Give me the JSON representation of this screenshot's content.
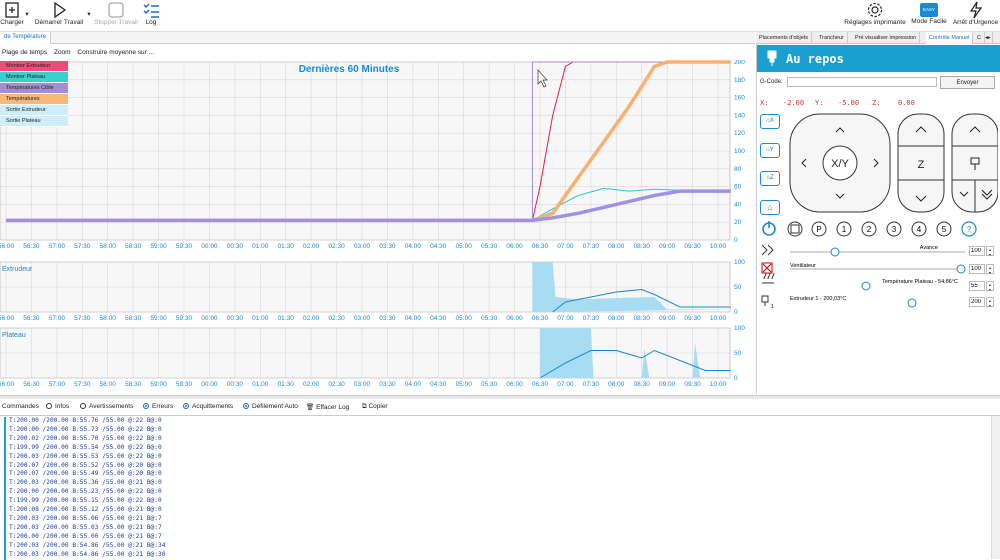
{
  "toolbar": {
    "load_label": "Charger",
    "start_label": "Démarrer Travail",
    "stop_label": "Stopper Travail",
    "log_label": "Log",
    "printer_settings_label": "Réglages imprimante",
    "easy_mode_label": "Mode Facile",
    "easy_badge": "EASY",
    "emergency_label": "Arrêt d'Urgence"
  },
  "left_tab": "de Température",
  "chart_menu": [
    "Plage de temps",
    "Zoom",
    "Construire moyenne sur ..."
  ],
  "legend": [
    {
      "label": "Montrer Extrudeur",
      "color": "#f04a7a"
    },
    {
      "label": "Montrer Plateau",
      "color": "#39d0d0"
    },
    {
      "label": "Températures Cible",
      "color": "#a98ad6"
    },
    {
      "label": "Températures",
      "color": "#f9b87a"
    },
    {
      "label": "Sortie Extrudeur",
      "color": "#cdeefa"
    },
    {
      "label": "Sortie Plateau",
      "color": "#cdeefa"
    }
  ],
  "chart_data": [
    {
      "type": "line",
      "title": "Dernières 60 Minutes",
      "x": [
        "56:00",
        "56:30",
        "57:00",
        "57:30",
        "58:00",
        "58:30",
        "59:00",
        "59:30",
        "00:00",
        "00:30",
        "01:00",
        "01:30",
        "02:00",
        "02:30",
        "03:00",
        "03:30",
        "04:00",
        "04:30",
        "05:00",
        "05:30",
        "06:00",
        "06:30",
        "07:00",
        "07:30",
        "08:00",
        "08:30",
        "09:00",
        "09:30",
        "10:00"
      ],
      "ylim": [
        0,
        200
      ],
      "yticks": [
        0,
        20,
        40,
        60,
        80,
        100,
        120,
        140,
        160,
        180,
        200
      ],
      "series": [
        {
          "name": "Montrer Extrudeur",
          "color": "#e0204a",
          "points": [
            [
              0,
              22
            ],
            [
              20.7,
              22
            ],
            [
              21.0,
              60
            ],
            [
              21.5,
              140
            ],
            [
              22.0,
              195
            ],
            [
              22.3,
              200
            ],
            [
              28.5,
              200
            ]
          ]
        },
        {
          "name": "Montrer Plateau",
          "color": "#30c8c0",
          "points": [
            [
              0,
              22
            ],
            [
              20.7,
              22
            ],
            [
              21.5,
              35
            ],
            [
              22.5,
              50
            ],
            [
              23.5,
              58
            ],
            [
              24.5,
              55
            ],
            [
              25.5,
              57
            ],
            [
              26.5,
              56
            ],
            [
              28.5,
              56
            ]
          ]
        },
        {
          "name": "Températures Cible",
          "color": "#a98ad6",
          "points": [
            [
              0,
              22
            ],
            [
              20.7,
              22
            ],
            [
              20.7,
              200
            ],
            [
              28.5,
              200
            ]
          ]
        },
        {
          "name": "Températures",
          "color": "#f9b070",
          "points": [
            [
              0,
              22
            ],
            [
              20.7,
              22
            ],
            [
              21.5,
              30
            ],
            [
              22.5,
              70
            ],
            [
              24.5,
              150
            ],
            [
              25.5,
              195
            ],
            [
              26.0,
              200
            ],
            [
              28.5,
              200
            ]
          ]
        },
        {
          "name": "Plateau cible",
          "color": "#a090e8",
          "points": [
            [
              0,
              22
            ],
            [
              20.7,
              22
            ],
            [
              21.5,
              25
            ],
            [
              22.5,
              30
            ],
            [
              24.0,
              40
            ],
            [
              25.5,
              50
            ],
            [
              26.5,
              55
            ],
            [
              28.5,
              55
            ]
          ]
        }
      ]
    },
    {
      "type": "area",
      "title": "Extrudeur",
      "x": [
        "56:00",
        "56:30",
        "57:00",
        "57:30",
        "58:00",
        "58:30",
        "59:00",
        "59:30",
        "00:00",
        "00:30",
        "01:00",
        "01:30",
        "02:00",
        "02:30",
        "03:00",
        "03:30",
        "04:00",
        "04:30",
        "05:00",
        "05:30",
        "06:00",
        "06:30",
        "07:00",
        "07:30",
        "08:00",
        "08:30",
        "09:00",
        "09:30",
        "10:00"
      ],
      "ylim": [
        0,
        100
      ],
      "yticks": [
        0,
        50,
        100
      ],
      "fill": [
        [
          20.7,
          0
        ],
        [
          20.7,
          100
        ],
        [
          21.5,
          100
        ],
        [
          21.6,
          30
        ],
        [
          22.5,
          25
        ],
        [
          24.0,
          28
        ],
        [
          25.5,
          30
        ],
        [
          26.0,
          5
        ],
        [
          28.5,
          5
        ]
      ],
      "line": [
        [
          21.5,
          0
        ],
        [
          22.0,
          20
        ],
        [
          24.0,
          40
        ],
        [
          25.0,
          45
        ],
        [
          25.5,
          35
        ],
        [
          26.5,
          10
        ],
        [
          28.5,
          10
        ]
      ]
    },
    {
      "type": "area",
      "title": "Plateau",
      "x": [
        "56:00",
        "56:30",
        "57:00",
        "57:30",
        "58:00",
        "58:30",
        "59:00",
        "59:30",
        "00:00",
        "00:30",
        "01:00",
        "01:30",
        "02:00",
        "02:30",
        "03:00",
        "03:30",
        "04:00",
        "04:30",
        "05:00",
        "05:30",
        "06:00",
        "06:30",
        "07:00",
        "07:30",
        "08:00",
        "08:30",
        "09:00",
        "09:30",
        "10:00"
      ],
      "ylim": [
        0,
        100
      ],
      "yticks": [
        0,
        50,
        100
      ],
      "fill": [
        [
          21.0,
          0
        ],
        [
          21.0,
          100
        ],
        [
          23.0,
          100
        ],
        [
          23.1,
          0
        ],
        [
          25.0,
          0
        ],
        [
          25.1,
          60
        ],
        [
          25.3,
          0
        ],
        [
          27.0,
          0
        ],
        [
          27.1,
          70
        ],
        [
          27.3,
          0
        ]
      ],
      "line": [
        [
          21.0,
          0
        ],
        [
          22.0,
          30
        ],
        [
          23.0,
          55
        ],
        [
          24.0,
          55
        ],
        [
          25.0,
          40
        ],
        [
          25.5,
          55
        ],
        [
          26.5,
          35
        ],
        [
          27.5,
          15
        ],
        [
          28.5,
          15
        ]
      ]
    }
  ],
  "right_tabs": [
    "Placements d'objets",
    "Trancheur",
    "Pré visualiser impression",
    "Contrôle Manuel",
    "C"
  ],
  "manual": {
    "status": "Au repos",
    "gcode_label": "G-Code:",
    "gcode_value": "",
    "send_label": "Envoyer",
    "x_label": "X:",
    "x_value": "-2.00",
    "y_label": "Y:",
    "y_value": "-5.00",
    "z_label": "Z:",
    "z_value": "0.00",
    "home_x": "X",
    "home_y": "Y",
    "home_z": "Z",
    "xy_label": "X/Y",
    "z_pad_label": "Z",
    "buttons": [
      "P",
      "1",
      "2",
      "3",
      "4",
      "5",
      "?"
    ],
    "avance_label": "Avance",
    "avance_value": "100",
    "fan_label": "Ventilateur",
    "fan_value": "100",
    "bed_label": "Température Plateau - 54,86°C",
    "bed_value": "55",
    "extruder_label": "Extrudeur 1 - 200,03°C",
    "extruder_value": "200",
    "extruder_index": "1"
  },
  "log_toolbar": {
    "commands": "Commandes",
    "infos": "Infos",
    "warnings": "Avertissements",
    "errors": "Erreurs",
    "acks": "Acquittements",
    "autoscroll": "Défilement Auto",
    "clear": "Effacer Log",
    "copy": "Copier"
  },
  "log_lines": [
    "T:200.00 /200.00 B:55.76 /55.00 @:22 B@:0",
    "T:200.00 /200.00 B:55.73 /55.00 @:22 B@:0",
    "T:200.02 /200.00 B:55.70 /55.00 @:22 B@:0",
    "T:199.99 /200.00 B:55.54 /55.00 @:22 B@:0",
    "T:200.03 /200.00 B:55.53 /55.00 @:22 B@:0",
    "T:200.07 /200.00 B:55.52 /55.00 @:20 B@:0",
    "T:200.07 /200.00 B:55.49 /55.00 @:20 B@:0",
    "T:200.03 /200.00 B:55.36 /55.00 @:21 B@:0",
    "T:200.00 /200.00 B:55.23 /55.00 @:22 B@:0",
    "T:199.99 /200.00 B:55.15 /55.00 @:22 B@:0",
    "T:200.08 /200.00 B:55.12 /55.00 @:21 B@:0",
    "T:200.03 /200.00 B:55.06 /55.00 @:21 B@:7",
    "T:200.03 /200.00 B:55.03 /55.00 @:21 B@:7",
    "T:200.00 /200.00 B:55.00 /55.00 @:21 B@:7",
    "T:200.03 /200.00 B:54.86 /55.00 @:21 B@:34",
    "T:200.03 /200.00 B:54.86 /55.00 @:21 B@:30"
  ]
}
